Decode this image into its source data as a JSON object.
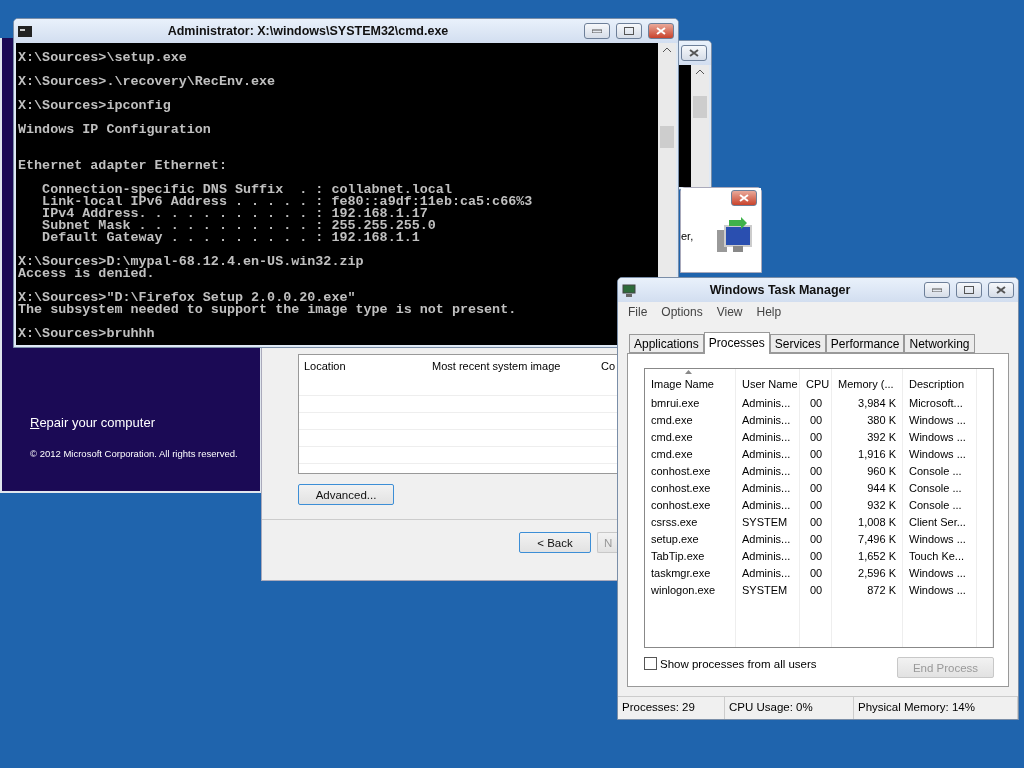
{
  "setup_screen": {
    "title": "Repair your computer",
    "copyright": "© 2012 Microsoft Corporation. All rights reserved."
  },
  "system_image_dialog": {
    "columns": [
      "Location",
      "Most recent system image",
      "Co"
    ],
    "advanced_button": "Advanced...",
    "buttons": [
      {
        "label": "< Back",
        "disabled": false
      },
      {
        "label": "N",
        "disabled": true
      }
    ]
  },
  "small_dialog": {
    "text": "er,"
  },
  "cmd_window": {
    "title": "Administrator: X:\\windows\\SYSTEM32\\cmd.exe",
    "console": "X:\\Sources>\\setup.exe\n\nX:\\Sources>.\\recovery\\RecEnv.exe\n\nX:\\Sources>ipconfig\n\nWindows IP Configuration\n\n\nEthernet adapter Ethernet:\n\n   Connection-specific DNS Suffix  . : collabnet.local\n   Link-local IPv6 Address . . . . . : fe80::a9df:11eb:ca5:c66%3\n   IPv4 Address. . . . . . . . . . . : 192.168.1.17\n   Subnet Mask . . . . . . . . . . . : 255.255.255.0\n   Default Gateway . . . . . . . . . : 192.168.1.1\n\nX:\\Sources>D:\\mypal-68.12.4.en-US.win32.zip\nAccess is denied.\n\nX:\\Sources>\"D:\\Firefox Setup 2.0.0.20.exe\"\nThe subsystem needed to support the image type is not present.\n\nX:\\Sources>bruhhh"
  },
  "task_manager": {
    "title": "Windows Task Manager",
    "menu": [
      "File",
      "Options",
      "View",
      "Help"
    ],
    "tabs": [
      {
        "label": "Applications",
        "selected": false
      },
      {
        "label": "Processes",
        "selected": true
      },
      {
        "label": "Services",
        "selected": false
      },
      {
        "label": "Performance",
        "selected": false
      },
      {
        "label": "Networking",
        "selected": false
      }
    ],
    "columns": [
      "Image Name",
      "User Name",
      "CPU",
      "Memory (...",
      "Description"
    ],
    "rows": [
      [
        "bmrui.exe",
        "Adminis...",
        "00",
        "3,984 K",
        "Microsoft..."
      ],
      [
        "cmd.exe",
        "Adminis...",
        "00",
        "380 K",
        "Windows ..."
      ],
      [
        "cmd.exe",
        "Adminis...",
        "00",
        "392 K",
        "Windows ..."
      ],
      [
        "cmd.exe",
        "Adminis...",
        "00",
        "1,916 K",
        "Windows ..."
      ],
      [
        "conhost.exe",
        "Adminis...",
        "00",
        "960 K",
        "Console ..."
      ],
      [
        "conhost.exe",
        "Adminis...",
        "00",
        "944 K",
        "Console ..."
      ],
      [
        "conhost.exe",
        "Adminis...",
        "00",
        "932 K",
        "Console ..."
      ],
      [
        "csrss.exe",
        "SYSTEM",
        "00",
        "1,008 K",
        "Client Ser..."
      ],
      [
        "setup.exe",
        "Adminis...",
        "00",
        "7,496 K",
        "Windows ..."
      ],
      [
        "TabTip.exe",
        "Adminis...",
        "00",
        "1,652 K",
        "Touch Ke..."
      ],
      [
        "taskmgr.exe",
        "Adminis...",
        "00",
        "2,596 K",
        "Windows ..."
      ],
      [
        "winlogon.exe",
        "SYSTEM",
        "00",
        "872 K",
        "Windows ..."
      ]
    ],
    "show_all_users": {
      "label": "Show processes from all users",
      "checked": false
    },
    "end_process": {
      "label": "End Process",
      "disabled": true
    },
    "status": [
      "Processes: 29",
      "CPU Usage: 0%",
      "Physical Memory: 14%"
    ]
  }
}
